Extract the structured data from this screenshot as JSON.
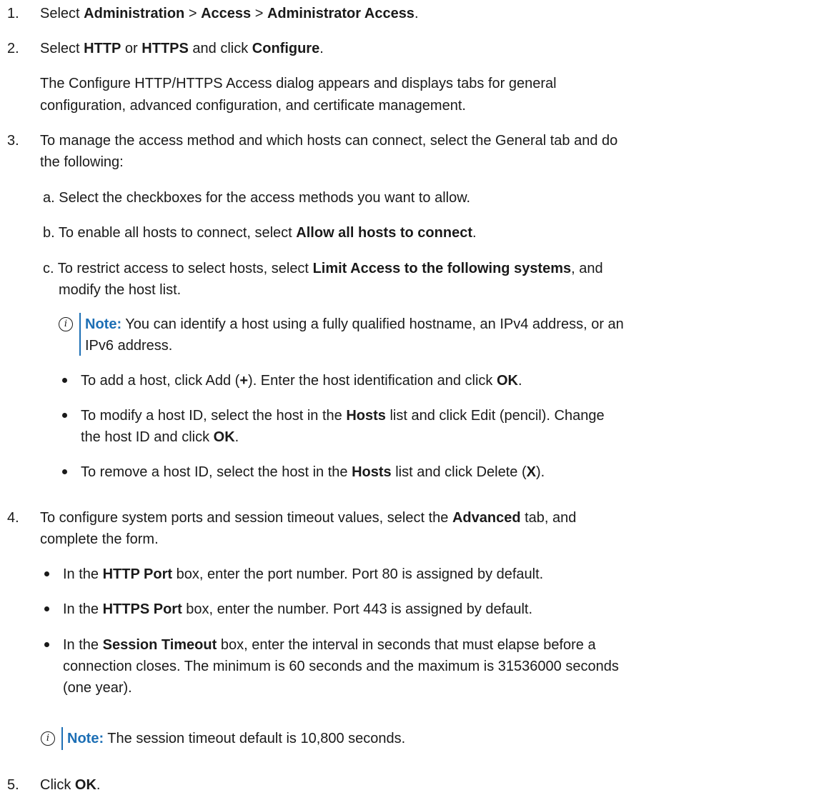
{
  "steps": {
    "s1": {
      "num": "1.",
      "t1": "Select ",
      "b1": "Administration",
      "t2": " > ",
      "b2": "Access",
      "t3": " > ",
      "b3": "Administrator Access",
      "t4": "."
    },
    "s2": {
      "num": "2.",
      "t1": "Select ",
      "b1": "HTTP",
      "t2": " or ",
      "b2": "HTTPS",
      "t3": " and click ",
      "b3": "Configure",
      "t4": ".",
      "para1": "The Configure HTTP/HTTPS Access dialog appears and displays tabs for general",
      "para2": "configuration, advanced configuration, and certificate management."
    },
    "s3": {
      "num": "3.",
      "line1": "To manage the access method and which hosts can connect, select the General tab and do",
      "line2": "the following:",
      "a": "a. Select the checkboxes for the access methods you want to allow.",
      "b_t1": "b. To enable all hosts to connect, select ",
      "b_b1": "Allow all hosts to connect",
      "b_t2": ".",
      "c_t1": "c. To restrict access to select hosts, select ",
      "c_b1": "Limit Access to the following systems",
      "c_t2": ", and",
      "c_line2": "modify the host list.",
      "note_label": "Note:",
      "note_line1": " You can identify a host using a fully qualified hostname, an IPv4 address, or an",
      "note_line2": "IPv6 address.",
      "bul1_t1": "To add a host, click Add (",
      "bul1_b1": "+",
      "bul1_t2": "). Enter the host identification and click ",
      "bul1_b2": "OK",
      "bul1_t3": ".",
      "bul2_t1": "To modify a host ID, select the host in the ",
      "bul2_b1": "Hosts",
      "bul2_t2": " list and click Edit (pencil). Change",
      "bul2_l2_t1": "the host ID and click ",
      "bul2_l2_b1": "OK",
      "bul2_l2_t2": ".",
      "bul3_t1": "To remove a host ID, select the host in the ",
      "bul3_b1": "Hosts",
      "bul3_t2": " list and click Delete (",
      "bul3_b2": "X",
      "bul3_t3": ")."
    },
    "s4": {
      "num": "4.",
      "l1_t1": "To configure system ports and session timeout values, select the ",
      "l1_b1": "Advanced",
      "l1_t2": " tab, and",
      "l2": "complete the form.",
      "bul1_t1": "In the ",
      "bul1_b1": "HTTP Port",
      "bul1_t2": " box, enter the port number. Port 80 is assigned by default.",
      "bul2_t1": "In the ",
      "bul2_b1": "HTTPS Port",
      "bul2_t2": " box, enter the number. Port 443 is assigned by default.",
      "bul3_t1": "In the ",
      "bul3_b1": "Session Timeout",
      "bul3_t2": " box, enter the interval in seconds that must elapse before a",
      "bul3_l2": "connection closes. The minimum is 60 seconds and the maximum is 31536000 seconds",
      "bul3_l3": "(one year).",
      "note_label": "Note:",
      "note_text": " The session timeout default is 10,800 seconds."
    },
    "s5": {
      "num": "5.",
      "t1": "Click ",
      "b1": "OK",
      "t2": "."
    }
  },
  "icons": {
    "note": "info-icon",
    "note_glyph": "i",
    "bullet": "bullet-dot"
  },
  "colors": {
    "accent": "#1d6fb5",
    "text": "#1a1a1a"
  }
}
